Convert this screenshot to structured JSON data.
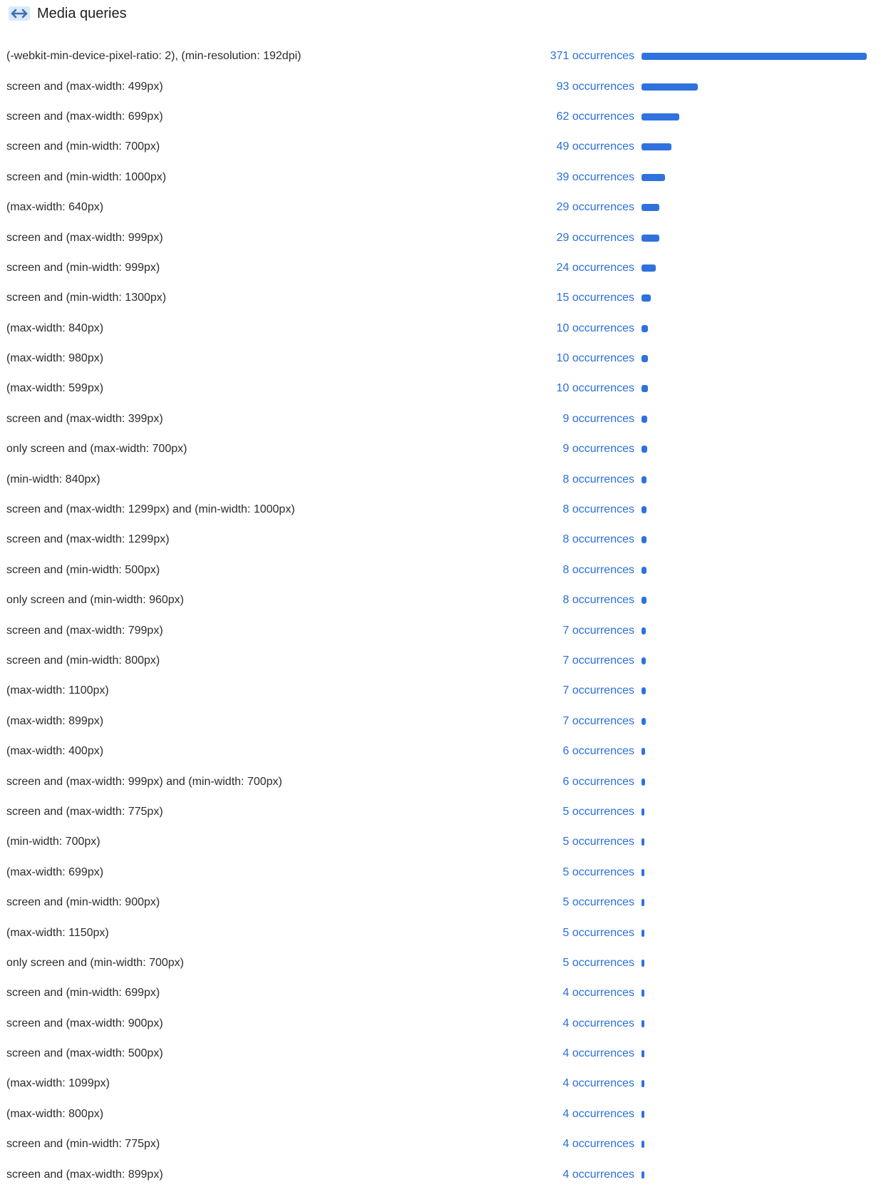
{
  "panel": {
    "title": "Media queries",
    "icon": "arrows-left-right-icon"
  },
  "colors": {
    "accent": "#2f72de",
    "link": "#2a6fdb",
    "text": "#2b2b2b",
    "icon_bg": "#dbe8f7"
  },
  "max_count": 371,
  "rows": [
    {
      "query": "(-webkit-min-device-pixel-ratio: 2), (min-resolution: 192dpi)",
      "occurrences_label": "371 occurrences",
      "count": 371
    },
    {
      "query": "screen and (max-width: 499px)",
      "occurrences_label": "93 occurrences",
      "count": 93
    },
    {
      "query": "screen and (max-width: 699px)",
      "occurrences_label": "62 occurrences",
      "count": 62
    },
    {
      "query": "screen and (min-width: 700px)",
      "occurrences_label": "49 occurrences",
      "count": 49
    },
    {
      "query": "screen and (min-width: 1000px)",
      "occurrences_label": "39 occurrences",
      "count": 39
    },
    {
      "query": "(max-width: 640px)",
      "occurrences_label": "29 occurrences",
      "count": 29
    },
    {
      "query": "screen and (max-width: 999px)",
      "occurrences_label": "29 occurrences",
      "count": 29
    },
    {
      "query": "screen and (min-width: 999px)",
      "occurrences_label": "24 occurrences",
      "count": 24
    },
    {
      "query": "screen and (min-width: 1300px)",
      "occurrences_label": "15 occurrences",
      "count": 15
    },
    {
      "query": "(max-width: 840px)",
      "occurrences_label": "10 occurrences",
      "count": 10
    },
    {
      "query": "(max-width: 980px)",
      "occurrences_label": "10 occurrences",
      "count": 10
    },
    {
      "query": "(max-width: 599px)",
      "occurrences_label": "10 occurrences",
      "count": 10
    },
    {
      "query": "screen and (max-width: 399px)",
      "occurrences_label": "9 occurrences",
      "count": 9
    },
    {
      "query": "only screen and (max-width: 700px)",
      "occurrences_label": "9 occurrences",
      "count": 9
    },
    {
      "query": "(min-width: 840px)",
      "occurrences_label": "8 occurrences",
      "count": 8
    },
    {
      "query": "screen and (max-width: 1299px) and (min-width: 1000px)",
      "occurrences_label": "8 occurrences",
      "count": 8
    },
    {
      "query": "screen and (max-width: 1299px)",
      "occurrences_label": "8 occurrences",
      "count": 8
    },
    {
      "query": "screen and (min-width: 500px)",
      "occurrences_label": "8 occurrences",
      "count": 8
    },
    {
      "query": "only screen and (min-width: 960px)",
      "occurrences_label": "8 occurrences",
      "count": 8
    },
    {
      "query": "screen and (max-width: 799px)",
      "occurrences_label": "7 occurrences",
      "count": 7
    },
    {
      "query": "screen and (min-width: 800px)",
      "occurrences_label": "7 occurrences",
      "count": 7
    },
    {
      "query": "(max-width: 1100px)",
      "occurrences_label": "7 occurrences",
      "count": 7
    },
    {
      "query": "(max-width: 899px)",
      "occurrences_label": "7 occurrences",
      "count": 7
    },
    {
      "query": "(max-width: 400px)",
      "occurrences_label": "6 occurrences",
      "count": 6
    },
    {
      "query": "screen and (max-width: 999px) and (min-width: 700px)",
      "occurrences_label": "6 occurrences",
      "count": 6
    },
    {
      "query": "screen and (max-width: 775px)",
      "occurrences_label": "5 occurrences",
      "count": 5
    },
    {
      "query": "(min-width: 700px)",
      "occurrences_label": "5 occurrences",
      "count": 5
    },
    {
      "query": "(max-width: 699px)",
      "occurrences_label": "5 occurrences",
      "count": 5
    },
    {
      "query": "screen and (min-width: 900px)",
      "occurrences_label": "5 occurrences",
      "count": 5
    },
    {
      "query": "(max-width: 1150px)",
      "occurrences_label": "5 occurrences",
      "count": 5
    },
    {
      "query": "only screen and (min-width: 700px)",
      "occurrences_label": "5 occurrences",
      "count": 5
    },
    {
      "query": "screen and (min-width: 699px)",
      "occurrences_label": "4 occurrences",
      "count": 4
    },
    {
      "query": "screen and (max-width: 900px)",
      "occurrences_label": "4 occurrences",
      "count": 4
    },
    {
      "query": "screen and (max-width: 500px)",
      "occurrences_label": "4 occurrences",
      "count": 4
    },
    {
      "query": "(max-width: 1099px)",
      "occurrences_label": "4 occurrences",
      "count": 4
    },
    {
      "query": "(max-width: 800px)",
      "occurrences_label": "4 occurrences",
      "count": 4
    },
    {
      "query": "screen and (min-width: 775px)",
      "occurrences_label": "4 occurrences",
      "count": 4
    },
    {
      "query": "screen and (max-width: 899px)",
      "occurrences_label": "4 occurrences",
      "count": 4
    }
  ]
}
